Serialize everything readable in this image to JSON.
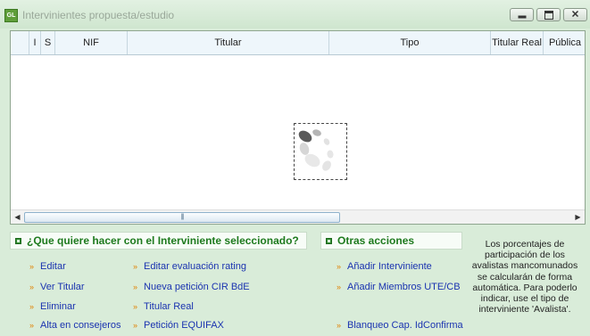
{
  "window": {
    "title": "Intervinientes propuesta/estudio",
    "app_icon_text": "GL",
    "buttons": [
      "minimize",
      "maximize",
      "close"
    ]
  },
  "grid": {
    "columns": [
      "I",
      "S",
      "NIF",
      "Titular",
      "Tipo",
      "Titular Real",
      "Pública"
    ],
    "rows": [],
    "loading": true
  },
  "selected_actions": {
    "title": "¿Que quiere hacer con el Interviniente seleccionado?",
    "items": [
      "Editar",
      "Ver Titular",
      "Eliminar",
      "Alta en consejeros",
      "Editar evaluación rating",
      "Nueva petición CIR BdE",
      "Titular Real",
      "Petición EQUIFAX"
    ]
  },
  "other_actions": {
    "title": "Otras acciones",
    "items": [
      "Añadir Interviniente",
      "Añadir Miembros UTE/CB",
      "Blanqueo Cap. IdConfirma"
    ]
  },
  "note": "Los porcentajes de participación de los avalistas mancomunados se calcularán de forma automática. Para poderlo indicar, use el tipo de interviniente 'Avalista'.",
  "colors": {
    "background": "#d9ecd9",
    "link": "#1a33b0",
    "bullet": "#e08000",
    "panel_title": "#1e7a1e"
  }
}
